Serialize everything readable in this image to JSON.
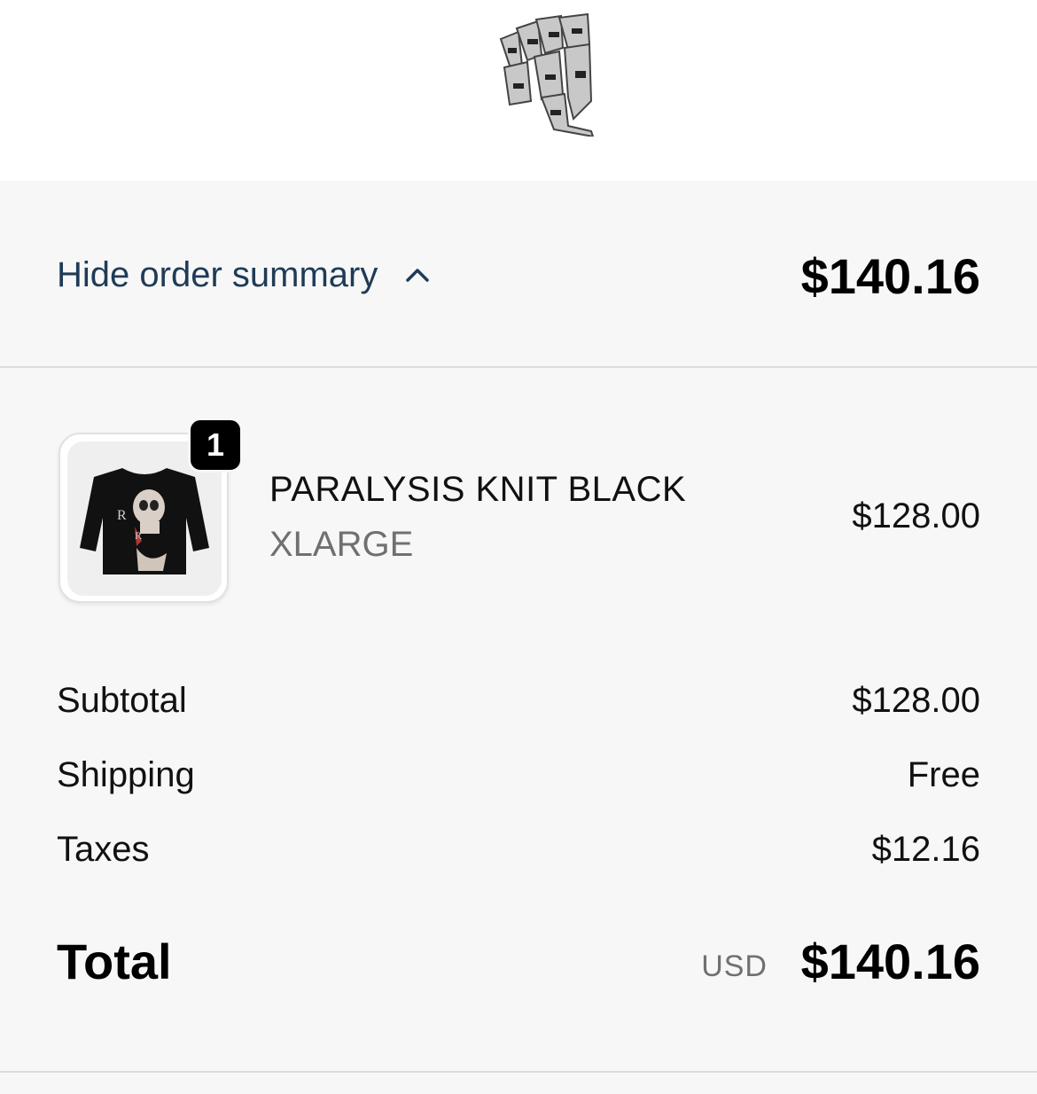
{
  "summary_toggle": {
    "label": "Hide order summary",
    "amount": "$140.16"
  },
  "item": {
    "name": "PARALYSIS KNIT BLACK",
    "variant": "XLARGE",
    "price": "$128.00",
    "quantity": "1",
    "image_icon": "black-knit-sweater-skull-graphic"
  },
  "costs": {
    "subtotal_label": "Subtotal",
    "subtotal_value": "$128.00",
    "shipping_label": "Shipping",
    "shipping_value": "Free",
    "taxes_label": "Taxes",
    "taxes_value": "$12.16"
  },
  "total": {
    "label": "Total",
    "currency": "USD",
    "value": "$140.16"
  },
  "colors": {
    "toggle_link": "#1f3b57",
    "summary_bg": "#f7f7f7",
    "muted_text": "#707070"
  }
}
